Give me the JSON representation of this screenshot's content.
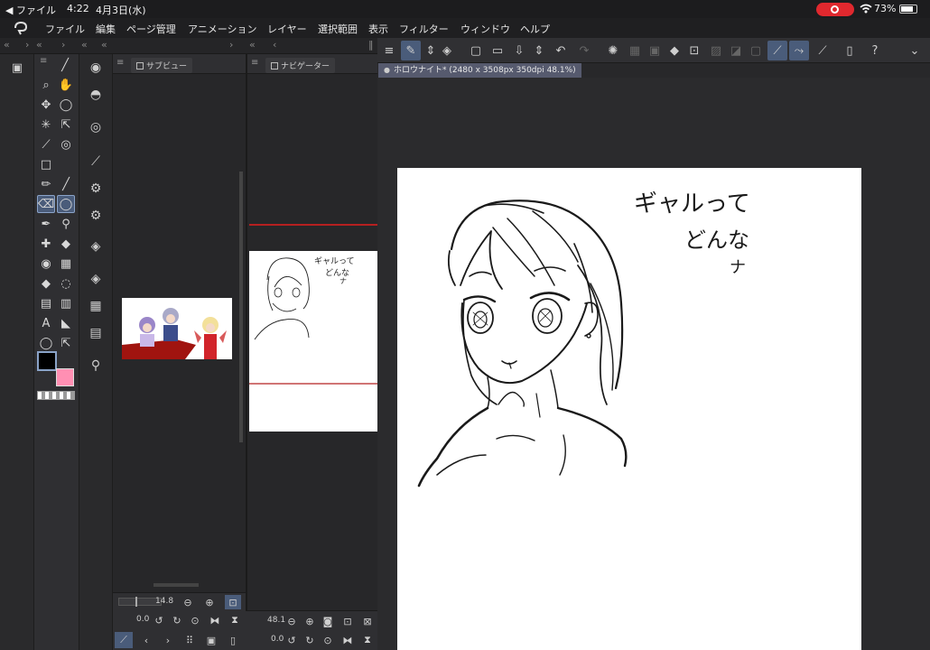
{
  "status_bar": {
    "back_label": "◀ ファイル",
    "time": "4:22",
    "date": "4月3日(水)",
    "battery": "73%"
  },
  "menu": {
    "items": [
      "ファイル",
      "編集",
      "ページ管理",
      "アニメーション",
      "レイヤー",
      "選択範囲",
      "表示",
      "フィルター",
      "ウィンドウ",
      "ヘルプ"
    ]
  },
  "subview": {
    "title": "サブビュー",
    "zoom_value": "14.8",
    "rotation_value": "0.0"
  },
  "navigator": {
    "title": "ナビゲーター",
    "zoom_value": "48.1",
    "rotation_value": "0.0"
  },
  "document": {
    "tab_title": "ホロウナイト* (2480 x 3508px 350dpi 48.1%)",
    "handwritten_line1": "ギャルって",
    "handwritten_line2": "どんな",
    "handwritten_line3": "ナ"
  },
  "colors": {
    "main_color": "#000000",
    "sub_color": "#ff8fb3",
    "accent": "#4a5c7a",
    "record_indicator": "#e0282e"
  },
  "icons": {
    "app_logo": "clip-studio-logo-icon",
    "wifi": "wifi-icon",
    "battery": "battery-icon"
  }
}
